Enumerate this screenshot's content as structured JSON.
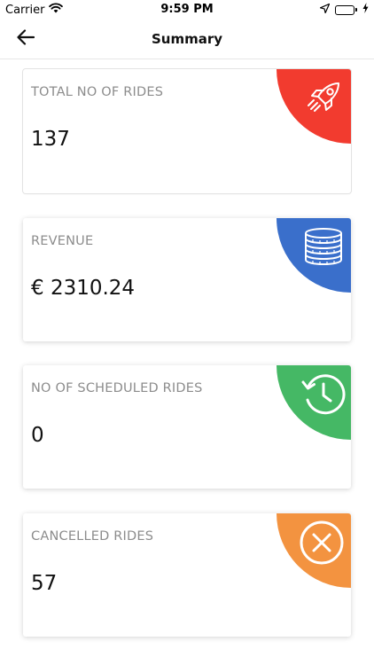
{
  "status_bar": {
    "carrier": "Carrier",
    "time": "9:59 PM",
    "wifi_icon": "wifi-icon",
    "location_icon": "location-arrow-icon",
    "battery_icon": "battery-icon",
    "charging_icon": "lightning-icon",
    "battery_level": 0.2
  },
  "nav": {
    "back_icon": "arrow-left-icon",
    "title": "Summary"
  },
  "cards": [
    {
      "label": "TOTAL NO OF RIDES",
      "value": "137",
      "icon": "rocket-icon",
      "color": "#f23b2f"
    },
    {
      "label": "REVENUE",
      "value": "€ 2310.24",
      "icon": "coins-icon",
      "color": "#3a6fcb"
    },
    {
      "label": "NO OF SCHEDULED RIDES",
      "value": "0",
      "icon": "history-clock-icon",
      "color": "#45b865"
    },
    {
      "label": "CANCELLED RIDES",
      "value": "57",
      "icon": "cancel-circle-icon",
      "color": "#f39340"
    }
  ]
}
